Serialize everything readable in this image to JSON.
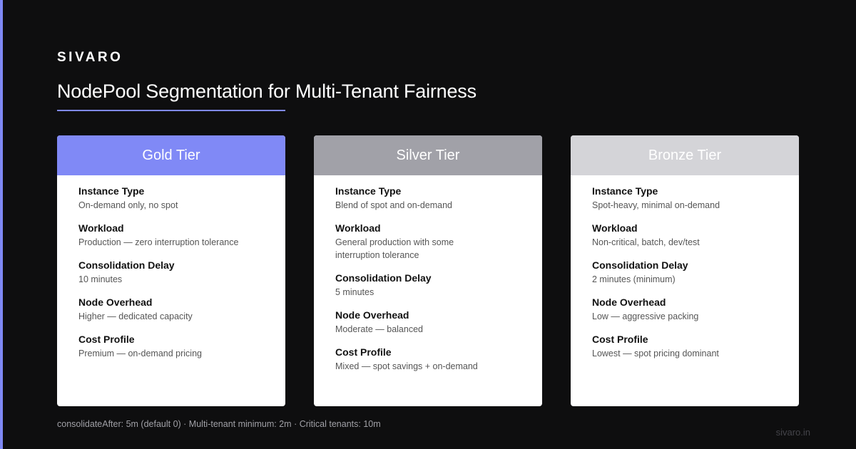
{
  "brand": "SIVARO",
  "title": "NodePool Segmentation for Multi-Tenant Fairness",
  "colors": {
    "accent": "#7f89f5",
    "background": "#0e0e0f",
    "gold": "#8089f6",
    "silver": "#a1a1a8",
    "bronze": "#d4d4d8"
  },
  "tiers": [
    {
      "name": "Gold Tier",
      "fields": [
        {
          "label": "Instance Type",
          "value": "On-demand only, no spot"
        },
        {
          "label": "Workload",
          "value": "Production — zero interruption tolerance"
        },
        {
          "label": "Consolidation Delay",
          "value": "10 minutes"
        },
        {
          "label": "Node Overhead",
          "value": "Higher — dedicated capacity"
        },
        {
          "label": "Cost Profile",
          "value": "Premium — on-demand pricing"
        }
      ]
    },
    {
      "name": "Silver Tier",
      "fields": [
        {
          "label": "Instance Type",
          "value": "Blend of spot and on-demand"
        },
        {
          "label": "Workload",
          "value": "General production with some interruption tolerance"
        },
        {
          "label": "Consolidation Delay",
          "value": "5 minutes"
        },
        {
          "label": "Node Overhead",
          "value": "Moderate — balanced"
        },
        {
          "label": "Cost Profile",
          "value": "Mixed — spot savings + on-demand"
        }
      ]
    },
    {
      "name": "Bronze Tier",
      "fields": [
        {
          "label": "Instance Type",
          "value": "Spot-heavy, minimal on-demand"
        },
        {
          "label": "Workload",
          "value": "Non-critical, batch, dev/test"
        },
        {
          "label": "Consolidation Delay",
          "value": "2 minutes (minimum)"
        },
        {
          "label": "Node Overhead",
          "value": "Low — aggressive packing"
        },
        {
          "label": "Cost Profile",
          "value": "Lowest — spot pricing dominant"
        }
      ]
    }
  ],
  "footer": {
    "note": "consolidateAfter: 5m (default 0) · Multi-tenant minimum: 2m · Critical tenants: 10m",
    "url": "sivaro.in"
  }
}
